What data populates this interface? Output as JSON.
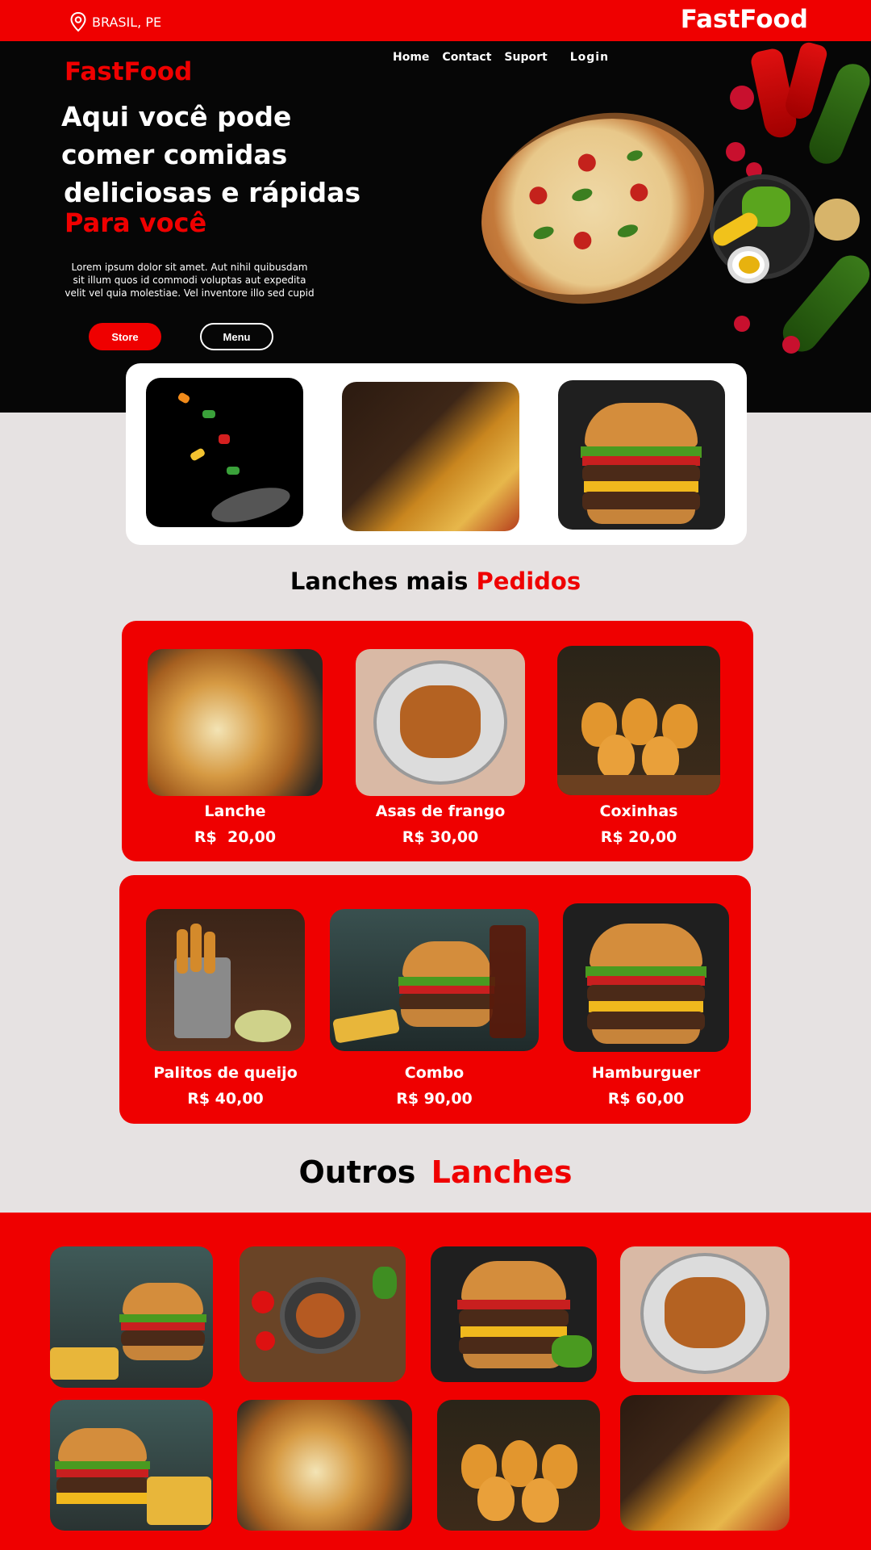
{
  "topbar": {
    "location": "BRASIL, PE",
    "brand": "FastFood"
  },
  "nav": {
    "home": "Home",
    "contact": "Contact",
    "support": "Suport",
    "login": "Login"
  },
  "hero": {
    "brand": "FastFood",
    "title_line1": "Aqui você pode",
    "title_line2": "comer comidas",
    "title_line3": "deliciosas e rápidas",
    "accent": "Para você",
    "description": "Lorem ipsum dolor sit amet. Aut nihil quibusdam sit illum quos id commodi voluptas aut expedita velit vel quia molestiae. Vel inventore illo sed cupid",
    "store_label": "Store",
    "menu_label": "Menu"
  },
  "popular": {
    "title_black": "Lanches mais",
    "title_red": "Pedidos",
    "row1": [
      {
        "name": "Lanche",
        "price": "R$  20,00"
      },
      {
        "name": "Asas de frango",
        "price": "R$ 30,00"
      },
      {
        "name": "Coxinhas",
        "price": "R$ 20,00"
      }
    ],
    "row2": [
      {
        "name": "Palitos de queijo",
        "price": "R$ 40,00"
      },
      {
        "name": "Combo",
        "price": "R$ 90,00"
      },
      {
        "name": "Hamburguer",
        "price": "R$ 60,00"
      }
    ]
  },
  "others": {
    "title_black": "Outros",
    "title_red": "Lanches"
  },
  "colors": {
    "accent": "#ef0000",
    "dark": "#060606",
    "bg": "#e6e2e2"
  }
}
